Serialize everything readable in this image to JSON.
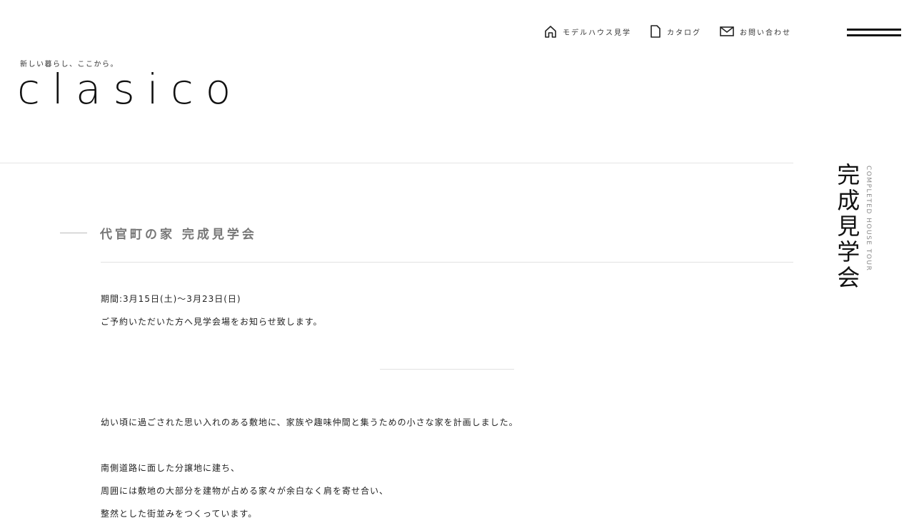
{
  "header": {
    "tagline": "新しい暮らし、ここから。",
    "logo": "clasico",
    "nav": [
      {
        "label": "モデルハウス見学",
        "icon": "house-icon"
      },
      {
        "label": "カタログ",
        "icon": "document-icon"
      },
      {
        "label": "お問い合わせ",
        "icon": "mail-icon"
      }
    ],
    "menu_icon": "hamburger-menu-icon"
  },
  "section": {
    "title_jp": "完成見学会",
    "title_en": "COMPLETED HOUSE TOUR"
  },
  "article": {
    "title": "代官町の家 完成見学会",
    "period": "期間:3月15日(土)〜3月23日(日)",
    "notice": "ご予約いただいた方へ見学会場をお知らせ致します。",
    "paragraphs": [
      "幼い頃に過ごされた思い入れのある敷地に、家族や趣味仲間と集うための小さな家を計画しました。",
      "南側道路に面した分譲地に建ち、",
      "周囲には敷地の大部分を建物が占める家々が余白なく肩を寄せ合い、",
      "整然とした街並みをつくっています。"
    ]
  },
  "colors": {
    "text": "#1a1a1a",
    "muted": "#777777",
    "divider": "#e5e5e5"
  }
}
